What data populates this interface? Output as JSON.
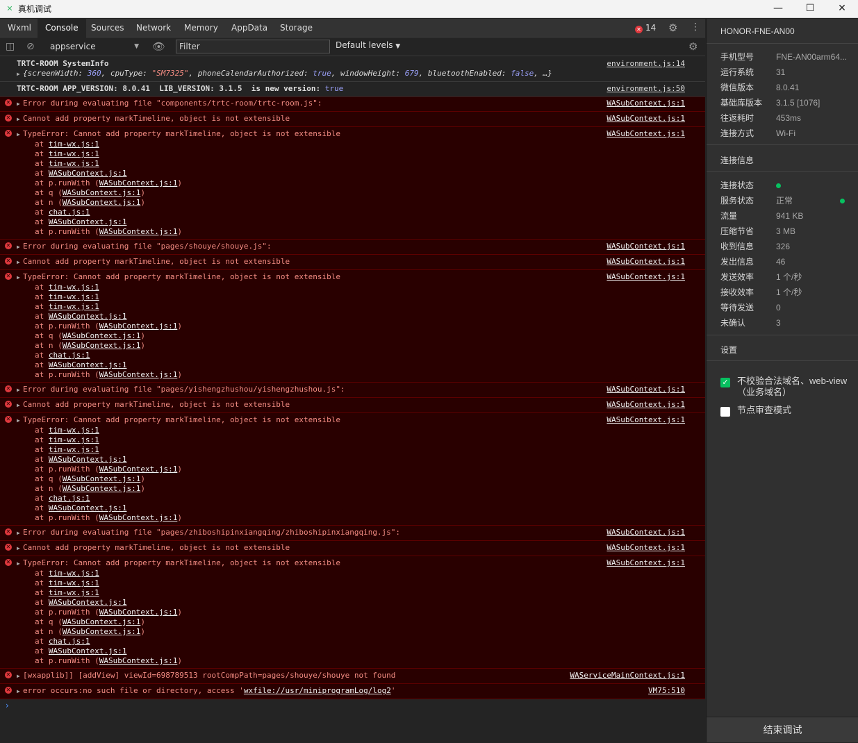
{
  "window": {
    "title": "真机调试",
    "minimize": "—",
    "maximize": "☐",
    "close": "✕"
  },
  "tabs": [
    "Wxml",
    "Console",
    "Sources",
    "Network",
    "Memory",
    "AppData",
    "Storage"
  ],
  "error_count": "14",
  "toolbar": {
    "context": "appservice",
    "filter_placeholder": "Filter",
    "levels": "Default levels"
  },
  "console": {
    "info1": {
      "line1": "TRTC-ROOM SystemInfo",
      "src": "environment.js:14",
      "obj": {
        "k1": "screenWidth",
        "v1": "360",
        "k2": "cpuType",
        "v2": "\"SM7325\"",
        "k3": "phoneCalendarAuthorized",
        "v3": "true",
        "k4": "windowHeight",
        "v4": "679",
        "k5": "bluetoothEnabled",
        "v5": "false",
        "tail": ", …}"
      }
    },
    "info2": {
      "text": "TRTC-ROOM APP_VERSION: 8.0.41  LIB_VERSION: 3.1.5  is new version:",
      "val": "true",
      "src": "environment.js:50"
    },
    "groups": [
      {
        "file_error": "Error during evaluating file \"components/trtc-room/trtc-room.js\":"
      },
      {
        "file_error": "Error during evaluating file \"pages/shouye/shouye.js\":"
      },
      {
        "file_error": "Error during evaluating file \"pages/yishengzhushou/yishengzhushou.js\":"
      },
      {
        "file_error": "Error during evaluating file \"pages/zhiboshipinxiangqing/zhiboshipinxiangqing.js\":"
      }
    ],
    "cannot_add": "Cannot add property markTimeline, object is not extensible",
    "type_error": "TypeError: Cannot add property markTimeline, object is not extensible",
    "wasub_src": "WASubContext.js:1",
    "stack": {
      "at": "at",
      "tim": "tim-wx.js:1",
      "wasub": "WASubContext.js:1",
      "runwith": "p.runWith",
      "q": "q",
      "n": "n",
      "chat": "chat.js:1"
    },
    "addview": {
      "text": "[wxapplib]] [addView] viewId=698789513 rootCompPath=pages/shouye/shouye not found",
      "src": "WAServiceMainContext.js:1"
    },
    "occurs": {
      "prefix": "error occurs:no such file or directory, access '",
      "path": "wxfile://usr/miniprogramLog/log2",
      "suffix": "'",
      "src": "VM75:510"
    },
    "prompt": "›"
  },
  "side": {
    "device": "HONOR-FNE-AN00",
    "info": [
      {
        "k": "手机型号",
        "v": "FNE-AN00arm64..."
      },
      {
        "k": "运行系统",
        "v": "31"
      },
      {
        "k": "微信版本",
        "v": "8.0.41"
      },
      {
        "k": "基础库版本",
        "v": "3.1.5 [1076]"
      },
      {
        "k": "往返耗时",
        "v": "453ms"
      },
      {
        "k": "连接方式",
        "v": "Wi-Fi"
      }
    ],
    "conn_title": "连接信息",
    "conn": [
      {
        "k": "连接状态",
        "v": ""
      },
      {
        "k": "服务状态",
        "v": "正常"
      },
      {
        "k": "流量",
        "v": "941 KB"
      },
      {
        "k": "压缩节省",
        "v": "3 MB"
      },
      {
        "k": "收到信息",
        "v": "326"
      },
      {
        "k": "发出信息",
        "v": "46"
      },
      {
        "k": "发送效率",
        "v": "1 个/秒"
      },
      {
        "k": "接收效率",
        "v": "1 个/秒"
      },
      {
        "k": "等待发送",
        "v": "0"
      },
      {
        "k": "未确认",
        "v": "3"
      }
    ],
    "settings_title": "设置",
    "opt1": "不校验合法域名、web-view（业务域名）",
    "opt2": "节点审查模式",
    "end_button": "结束调试"
  }
}
